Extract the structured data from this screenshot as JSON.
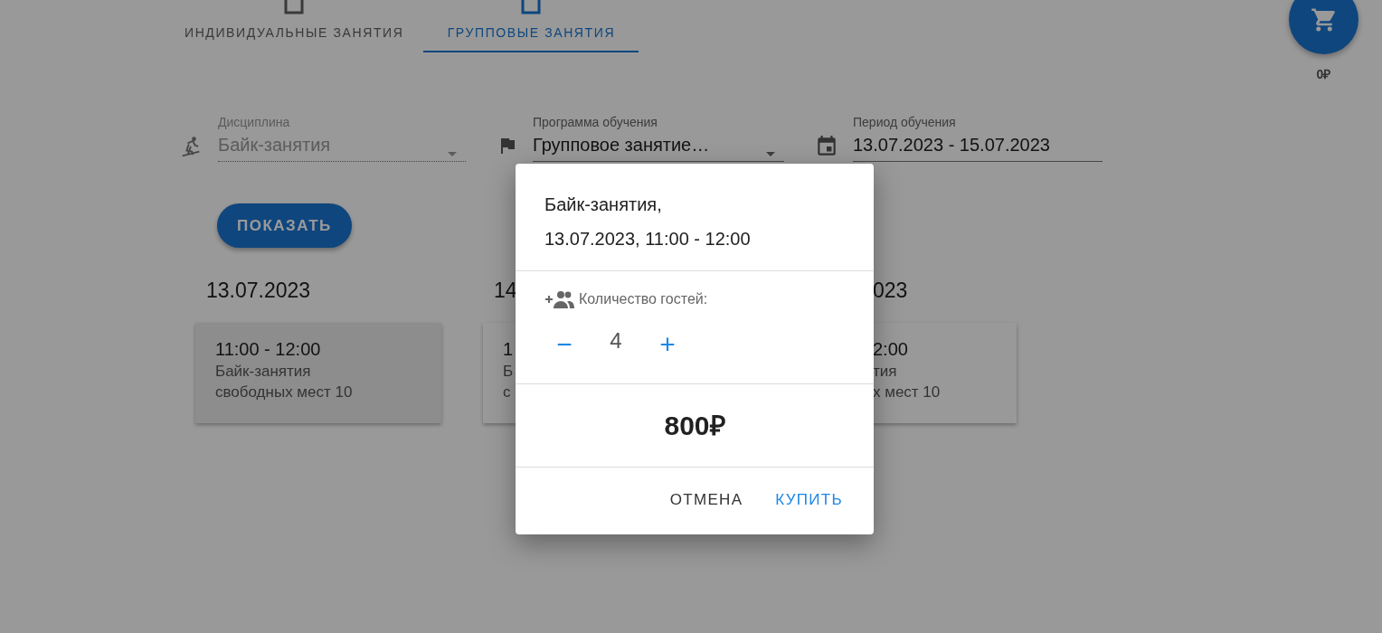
{
  "tabs": [
    {
      "label": "ИНДИВИДУАЛЬНЫЕ ЗАНЯТИЯ",
      "selected": false
    },
    {
      "label": "ГРУППОВЫЕ ЗАНЯТИЯ",
      "selected": true
    }
  ],
  "cart": {
    "total": "0₽"
  },
  "filters": [
    {
      "kind": "discipline",
      "label": "Дисциплина",
      "value": "Байк-занятия",
      "dropdown": true,
      "disabled": true
    },
    {
      "kind": "program",
      "label": "Программа обучения",
      "value": "Групповое занятие…",
      "dropdown": true,
      "disabled": false
    },
    {
      "kind": "period",
      "label": "Период обучения",
      "value": "13.07.2023 - 15.07.2023",
      "dropdown": false,
      "disabled": false
    }
  ],
  "show_button": "ПОКАЗАТЬ",
  "days": [
    {
      "kind": "full",
      "date": "13.07.2023",
      "sessions": [
        {
          "time": "11:00 - 12:00",
          "name": "Байк-занятия",
          "seats": "свободных мест 10",
          "selected": true
        }
      ]
    },
    {
      "kind": "cut-right",
      "date": "14",
      "sessions": [
        {
          "time": "1",
          "name": "Б",
          "seats": "с",
          "selected": false
        }
      ]
    },
    {
      "kind": "cut-left",
      "date": "023",
      "sessions": [
        {
          "time": "2:00",
          "name": "тия",
          "seats": "х мест 10",
          "selected": false
        }
      ]
    }
  ],
  "dialog": {
    "title_lines": [
      "Байк-занятия,",
      "13.07.2023, 11:00 - 12:00"
    ],
    "guests_label": "Количество гостей:",
    "decrement": "−",
    "count": "4",
    "increment": "+",
    "price": "800₽",
    "actions": [
      {
        "kind": "secondary",
        "label": "ОТМЕНА"
      },
      {
        "kind": "primary",
        "label": "КУПИТЬ"
      }
    ]
  }
}
